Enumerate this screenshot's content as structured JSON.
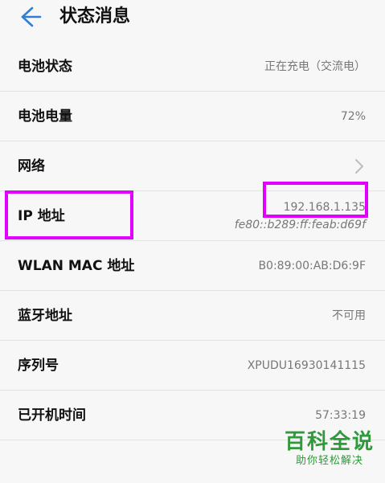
{
  "header": {
    "title": "状态消息"
  },
  "rows": [
    {
      "label": "电池状态",
      "value": "正在充电（交流电）"
    },
    {
      "label": "电池电量",
      "value": "72%"
    },
    {
      "label": "网络",
      "value": ""
    },
    {
      "label": "IP 地址",
      "value": "192.168.1.135",
      "value2": "fe80::b289:ff:feab:d69f"
    },
    {
      "label": "WLAN MAC 地址",
      "value": "B0:89:00:AB:D6:9F"
    },
    {
      "label": "蓝牙地址",
      "value": "不可用"
    },
    {
      "label": "序列号",
      "value": "XPUDU16930141115"
    },
    {
      "label": "已开机时间",
      "value": "57:33:19"
    }
  ],
  "icons": {
    "back": "back-arrow-icon",
    "network_chevron": "chevron-right-icon"
  },
  "colors": {
    "accent": "#2f7fd6",
    "highlight": "#e100ff",
    "watermark": "#2e9a3a"
  },
  "watermark": {
    "title": "百科全说",
    "subtitle": "助你轻松解决"
  }
}
